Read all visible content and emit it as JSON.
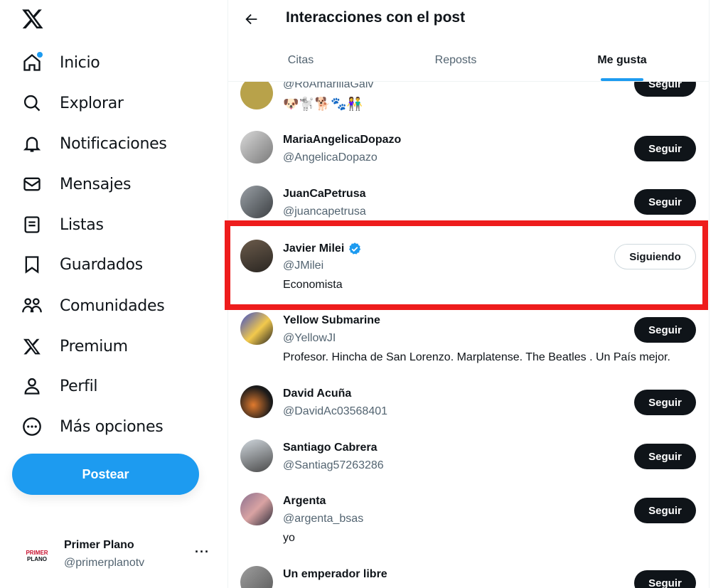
{
  "sidebar": {
    "logo": "x-logo-icon",
    "items": [
      {
        "label": "Inicio",
        "icon": "home-icon",
        "active": true
      },
      {
        "label": "Explorar",
        "icon": "search-icon"
      },
      {
        "label": "Notificaciones",
        "icon": "bell-icon"
      },
      {
        "label": "Mensajes",
        "icon": "mail-icon"
      },
      {
        "label": "Listas",
        "icon": "list-icon"
      },
      {
        "label": "Guardados",
        "icon": "bookmark-icon"
      },
      {
        "label": "Comunidades",
        "icon": "communities-icon"
      },
      {
        "label": "Premium",
        "icon": "x-logo-icon"
      },
      {
        "label": "Perfil",
        "icon": "person-icon"
      },
      {
        "label": "Más opciones",
        "icon": "more-circle-icon"
      }
    ],
    "post_label": "Postear",
    "account": {
      "avatar_text_1": "PRIMER",
      "avatar_text_2": "PLANO",
      "name": "Primer Plano",
      "handle": "@primerplanotv",
      "more": "···"
    }
  },
  "header": {
    "title": "Interacciones con el post",
    "tabs": [
      {
        "label": "Citas"
      },
      {
        "label": "Reposts"
      },
      {
        "label": "Me gusta",
        "active": true
      }
    ]
  },
  "users": [
    {
      "name": "",
      "handle": "@RoAmarillaGalv",
      "bio": "🐶🐩🐕🐾👫",
      "button": "Seguir"
    },
    {
      "name": "MariaAngelicaDopazo",
      "handle": "@AngelicaDopazo",
      "bio": "",
      "button": "Seguir"
    },
    {
      "name": "JuanCaPetrusa",
      "handle": "@juancapetrusa",
      "bio": "",
      "button": "Seguir"
    },
    {
      "name": "Javier Milei",
      "handle": "@JMilei",
      "bio": "Economista",
      "button": "Siguiendo",
      "verified": true
    },
    {
      "name": "Yellow Submarine",
      "handle": "@YellowJI",
      "bio": "Profesor. Hincha de San Lorenzo. Marplatense. The Beatles . Un País mejor.",
      "button": "Seguir"
    },
    {
      "name": "David Acuña",
      "handle": "@DavidAc03568401",
      "bio": "",
      "button": "Seguir"
    },
    {
      "name": "Santiago Cabrera",
      "handle": "@Santiag57263286",
      "bio": "",
      "button": "Seguir"
    },
    {
      "name": "Argenta",
      "handle": "@argenta_bsas",
      "bio": "yo",
      "button": "Seguir"
    },
    {
      "name": "Un emperador libre",
      "handle": "",
      "bio": "",
      "button": "Seguir"
    }
  ],
  "colors": {
    "accent": "#1d9bf0",
    "highlight_box": "#ee1c1c",
    "text": "#0f1419",
    "muted": "#536471"
  }
}
